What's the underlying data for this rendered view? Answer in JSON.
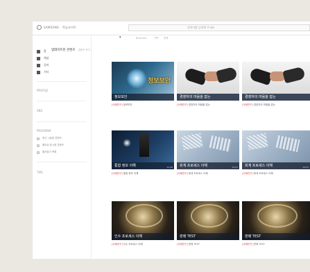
{
  "topbar": {
    "logo_text": "SAMSUNG · 학습사이트",
    "search_placeholder": "검색어를 입력해 주세요"
  },
  "subbar": {
    "items": [
      "Business",
      "구독",
      "전체"
    ]
  },
  "sidebar": {
    "items": [
      {
        "label": "홈"
      },
      {
        "label": "채널"
      },
      {
        "label": "강좌"
      },
      {
        "label": "기타"
      }
    ],
    "sections": [
      "PROFILE",
      "SNS",
      "PROGRAM",
      "TIPS"
    ],
    "program_items": [
      {
        "label": "최근 시청한 콘텐츠"
      },
      {
        "label": "좋아요 표시한 콘텐츠"
      },
      {
        "label": "즐겨찾기 목록"
      }
    ]
  },
  "main": {
    "section_title": "업데이트된 콘텐츠",
    "section_meta": "콘텐츠 보기",
    "cards": [
      {
        "title": "정보보안",
        "time": "",
        "caption_tag": "[사례연구]",
        "caption": " 정보보안"
      },
      {
        "title": "경영자의 마음을 잡는",
        "time": "",
        "caption_tag": "[사례연구]",
        "caption": " 경영자의 마음을 잡는"
      },
      {
        "title": "경영자의 마음을 잡는",
        "time": "",
        "caption_tag": "[사례연구]",
        "caption": " 경영자의 마음을 잡는"
      },
      {
        "title": "통합 정보 이해",
        "time": "12:40",
        "caption_tag": "[사례연구]",
        "caption": " 통합 정보 이해"
      },
      {
        "title": "회계 프로세스 이해",
        "time": "13:21",
        "caption_tag": "[사례연구]",
        "caption": " 회계 프로세스 이해"
      },
      {
        "title": "회계 프로세스 이해",
        "time": "13:21",
        "caption_tag": "[사례연구]",
        "caption": " 회계 프로세스 이해"
      },
      {
        "title": "인수 프로세스 이해",
        "time": "",
        "caption_tag": "[사례연구]",
        "caption": " 인수 프로세스 이해"
      },
      {
        "title": "판매 TEST",
        "time": "",
        "caption_tag": "[사례연구]",
        "caption": " 판매 TEST"
      },
      {
        "title": "판매 TEST",
        "time": "",
        "caption_tag": "[사례연구]",
        "caption": " 판매 TEST"
      }
    ]
  },
  "colors": {
    "page_bg": "#ebe8e2",
    "caption_tag": "#d04040",
    "label_bg": "#1e2d3d"
  }
}
